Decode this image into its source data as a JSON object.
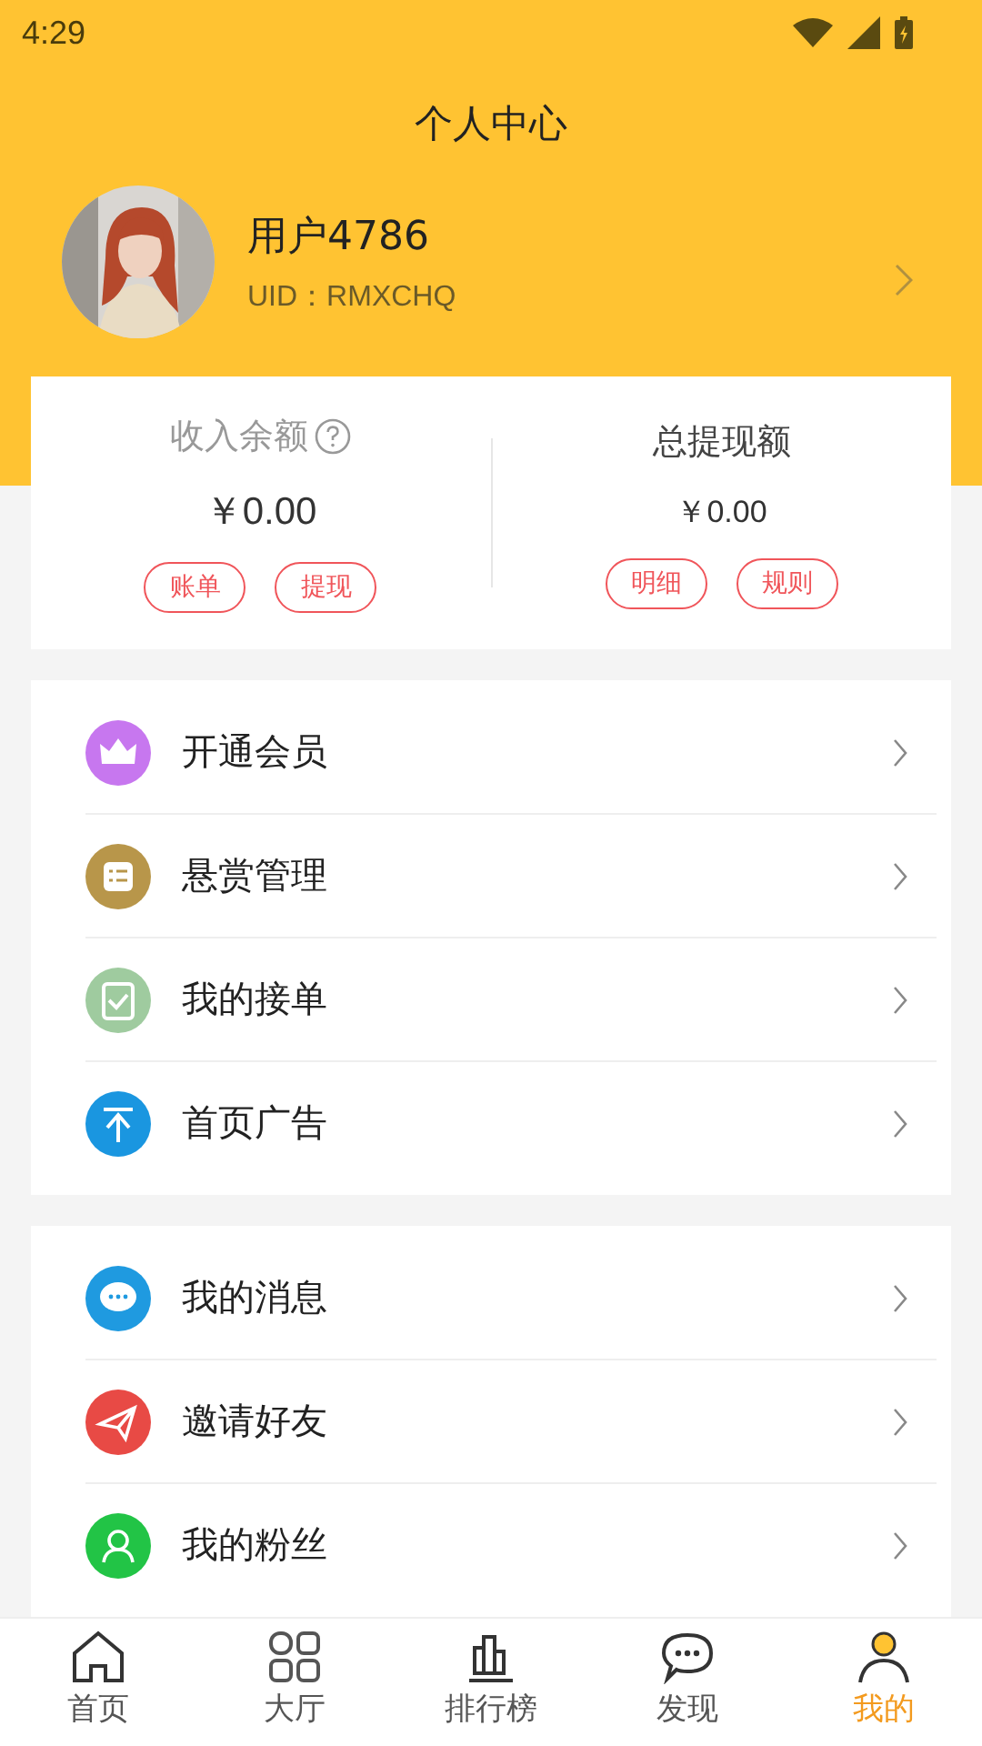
{
  "status_bar": {
    "time": "4:29"
  },
  "header": {
    "title": "个人中心"
  },
  "profile": {
    "name": "用户4786",
    "uid": "UID：RMXCHQ"
  },
  "balance": [
    {
      "label": "收入余额",
      "help": true,
      "amount": "￥0.00",
      "buttons": [
        "账单",
        "提现"
      ]
    },
    {
      "label": "总提现额",
      "help": false,
      "amount": "￥0.00",
      "buttons": [
        "明细",
        "规则"
      ]
    }
  ],
  "menu_groups": [
    [
      {
        "label": "开通会员",
        "kind": "crown",
        "color": "#c777ef"
      },
      {
        "label": "悬赏管理",
        "kind": "list",
        "color": "#b8964a"
      },
      {
        "label": "我的接单",
        "kind": "clipboard",
        "color": "#9fcb9f"
      },
      {
        "label": "首页广告",
        "kind": "top",
        "color": "#1a96e0"
      }
    ],
    [
      {
        "label": "我的消息",
        "kind": "chat",
        "color": "#1f9ae0"
      },
      {
        "label": "邀请好友",
        "kind": "plane",
        "color": "#e84a45"
      },
      {
        "label": "我的粉丝",
        "kind": "fans",
        "color": "#22c446"
      }
    ]
  ],
  "tab_bar": [
    {
      "label": "首页",
      "kind": "home",
      "selected": false
    },
    {
      "label": "大厅",
      "kind": "grid",
      "selected": false
    },
    {
      "label": "排行榜",
      "kind": "chart",
      "selected": false
    },
    {
      "label": "发现",
      "kind": "chat",
      "selected": false
    },
    {
      "label": "我的",
      "kind": "user",
      "selected": true
    }
  ]
}
